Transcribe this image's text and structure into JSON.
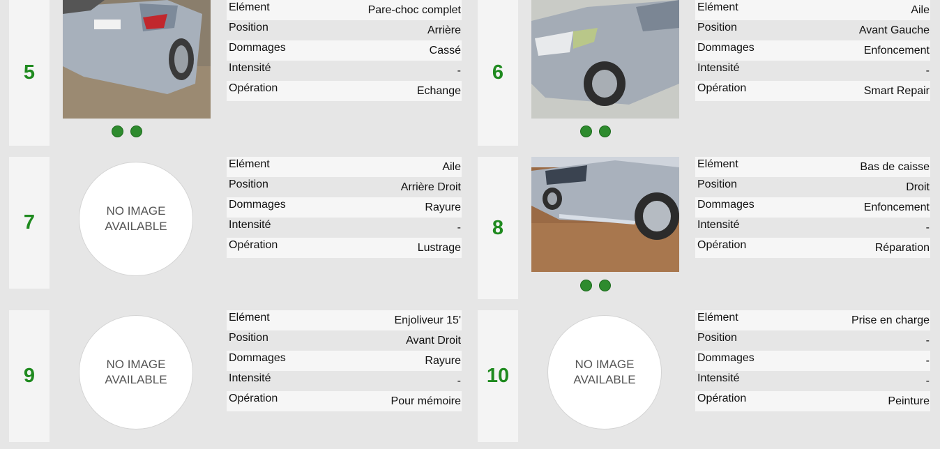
{
  "damages": [
    {
      "number": "5",
      "image": "photo-rear-bumper",
      "fields": [
        {
          "label": "Elément",
          "value": "Pare-choc complet"
        },
        {
          "label": "Position",
          "value": "Arrière"
        },
        {
          "label": "Dommages",
          "value": "Cassé"
        },
        {
          "label": "Intensité",
          "value": "-"
        },
        {
          "label": "Opération",
          "value": "Echange"
        }
      ],
      "dots": 2
    },
    {
      "number": "6",
      "image": "photo-front-left-fender",
      "fields": [
        {
          "label": "Elément",
          "value": "Aile"
        },
        {
          "label": "Position",
          "value": "Avant Gauche"
        },
        {
          "label": "Dommages",
          "value": "Enfoncement"
        },
        {
          "label": "Intensité",
          "value": "-"
        },
        {
          "label": "Opération",
          "value": "Smart Repair"
        }
      ],
      "dots": 2
    },
    {
      "number": "7",
      "image": "no-image",
      "no_image_text": [
        "NO IMAGE",
        "AVAILABLE"
      ],
      "fields": [
        {
          "label": "Elément",
          "value": "Aile"
        },
        {
          "label": "Position",
          "value": "Arrière Droit"
        },
        {
          "label": "Dommages",
          "value": "Rayure"
        },
        {
          "label": "Intensité",
          "value": "-"
        },
        {
          "label": "Opération",
          "value": "Lustrage"
        }
      ],
      "dots": 0
    },
    {
      "number": "8",
      "image": "photo-right-side-sill",
      "fields": [
        {
          "label": "Elément",
          "value": "Bas de caisse"
        },
        {
          "label": "Position",
          "value": "Droit"
        },
        {
          "label": "Dommages",
          "value": "Enfoncement"
        },
        {
          "label": "Intensité",
          "value": "-"
        },
        {
          "label": "Opération",
          "value": "Réparation"
        }
      ],
      "dots": 2
    },
    {
      "number": "9",
      "image": "no-image",
      "no_image_text": [
        "NO IMAGE",
        "AVAILABLE"
      ],
      "fields": [
        {
          "label": "Elément",
          "value": "Enjoliveur 15'"
        },
        {
          "label": "Position",
          "value": "Avant Droit"
        },
        {
          "label": "Dommages",
          "value": "Rayure"
        },
        {
          "label": "Intensité",
          "value": "-"
        },
        {
          "label": "Opération",
          "value": "Pour mémoire"
        }
      ],
      "dots": 0
    },
    {
      "number": "10",
      "image": "no-image",
      "no_image_text": [
        "NO IMAGE",
        "AVAILABLE"
      ],
      "fields": [
        {
          "label": "Elément",
          "value": "Prise en charge"
        },
        {
          "label": "Position",
          "value": "-"
        },
        {
          "label": "Dommages",
          "value": "-"
        },
        {
          "label": "Intensité",
          "value": "-"
        },
        {
          "label": "Opération",
          "value": "Peinture"
        }
      ],
      "dots": 0
    }
  ],
  "colors": {
    "number": "#1f8a1f",
    "dot": "#2e8b2e",
    "background": "#e6e6e6"
  }
}
